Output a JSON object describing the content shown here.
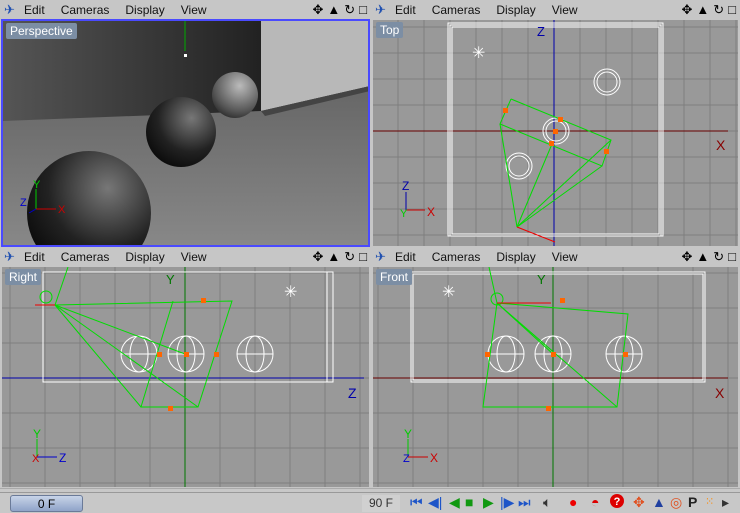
{
  "menu": {
    "edit": "Edit",
    "cameras": "Cameras",
    "display": "Display",
    "view": "View"
  },
  "viewports": [
    {
      "label": "Perspective",
      "active": true
    },
    {
      "label": "Top",
      "axis_h": "X",
      "axis_v": "Z",
      "gizmo_v": "Z",
      "gizmo_h": "X"
    },
    {
      "label": "Right",
      "axis_h": "Z",
      "axis_v": "Y",
      "gizmo_v": "Y",
      "gizmo_h": "Z"
    },
    {
      "label": "Front",
      "axis_h": "X",
      "axis_v": "Y",
      "gizmo_v": "Y",
      "gizmo_h": "X"
    }
  ],
  "perspective_gizmo": {
    "y": "Y",
    "z": "Z",
    "x": "X"
  },
  "timeline": {
    "current_frame": "0 F",
    "end_frame": "90 F"
  },
  "colors": {
    "accent": "#4040ff",
    "x_axis": "#cc0000",
    "y_axis": "#00aa00",
    "z_axis": "#0000aa",
    "camera": "#00dd00",
    "handle": "#ff6600"
  }
}
